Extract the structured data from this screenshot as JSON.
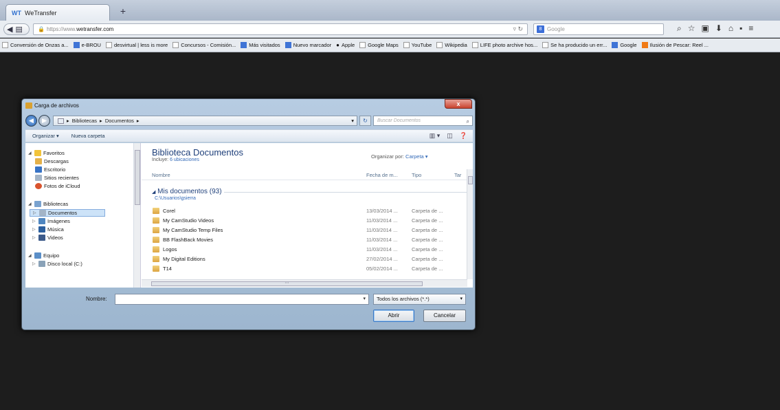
{
  "browser": {
    "tab_title": "WeTransfer",
    "new_tab": "+",
    "url_prefix": "https://www.",
    "url_domain": "wetransfer.com",
    "search_engine": "Google",
    "bookmarks": [
      {
        "label": "Conversión de Onzas a...",
        "icon": "page-icon"
      },
      {
        "label": "e-BROU",
        "icon": "brou-icon"
      },
      {
        "label": "desvirtual | less is more",
        "icon": "page-icon"
      },
      {
        "label": "Concursos - Comisión...",
        "icon": "page-icon"
      },
      {
        "label": "Más visitados",
        "icon": "star-icon"
      },
      {
        "label": "Nuevo marcador",
        "icon": "google-icon"
      },
      {
        "label": "Apple",
        "icon": "apple-icon"
      },
      {
        "label": "Google Maps",
        "icon": "page-icon"
      },
      {
        "label": "YouTube",
        "icon": "page-icon"
      },
      {
        "label": "Wikipedia",
        "icon": "page-icon"
      },
      {
        "label": "LIFE photo archive hos...",
        "icon": "page-icon"
      },
      {
        "label": "Se ha producido un err...",
        "icon": "page-icon"
      },
      {
        "label": "Google",
        "icon": "google-icon"
      },
      {
        "label": "Ilusión de Pescar: Reel ...",
        "icon": "blogger-icon"
      }
    ]
  },
  "dialog": {
    "title": "Carga de archivos",
    "close": "x",
    "breadcrumb": [
      "Bibliotecas",
      "Documentos"
    ],
    "search_placeholder": "Buscar Documentos",
    "toolbar": {
      "organize": "Organizar ▾",
      "new_folder": "Nueva carpeta"
    },
    "nav": {
      "favorites": "Favoritos",
      "downloads": "Descargas",
      "desktop": "Escritorio",
      "recent": "Sitios recientes",
      "icloud": "Fotos de iCloud",
      "libraries": "Bibliotecas",
      "documents": "Documentos",
      "images": "Imágenes",
      "music": "Música",
      "videos": "Videos",
      "computer": "Equipo",
      "local_disk": "Disco local (C:)"
    },
    "library_title": "Biblioteca Documentos",
    "includes_label": "Incluye:",
    "includes_link": "6 ubicaciones",
    "arrange_label": "Organizar por:",
    "arrange_value": "Carpeta ▾",
    "columns": {
      "name": "Nombre",
      "date": "Fecha de m...",
      "type": "Tipo",
      "size": "Tar"
    },
    "group_title": "Mis documentos (93)",
    "group_path": "C:\\Usuarios\\gsierra",
    "files": [
      {
        "name": "Corel",
        "date": "13/03/2014 ...",
        "type": "Carpeta de ..."
      },
      {
        "name": "My CamStudio Videos",
        "date": "11/03/2014 ...",
        "type": "Carpeta de ..."
      },
      {
        "name": "My CamStudio Temp Files",
        "date": "11/03/2014 ...",
        "type": "Carpeta de ..."
      },
      {
        "name": "BB FlashBack Movies",
        "date": "11/03/2014 ...",
        "type": "Carpeta de ..."
      },
      {
        "name": "Logos",
        "date": "11/03/2014 ...",
        "type": "Carpeta de ..."
      },
      {
        "name": "My Digital Editions",
        "date": "27/02/2014 ...",
        "type": "Carpeta de ..."
      },
      {
        "name": "T14",
        "date": "05/02/2014 ...",
        "type": "Carpeta de ..."
      }
    ],
    "filename_label": "Nombre:",
    "filename_value": "",
    "filter": "Todos los archivos (*.*)",
    "open_button": "Abrir",
    "cancel_button": "Cancelar"
  }
}
